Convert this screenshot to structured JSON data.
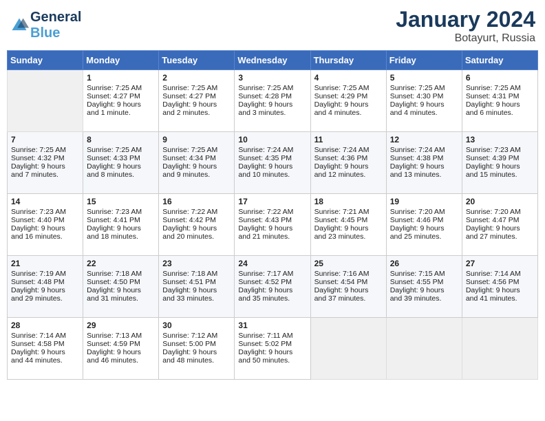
{
  "header": {
    "logo_general": "General",
    "logo_blue": "Blue",
    "month_title": "January 2024",
    "location": "Botayurt, Russia"
  },
  "weekdays": [
    "Sunday",
    "Monday",
    "Tuesday",
    "Wednesday",
    "Thursday",
    "Friday",
    "Saturday"
  ],
  "weeks": [
    [
      {
        "day": "",
        "empty": true
      },
      {
        "day": "1",
        "sunrise": "7:25 AM",
        "sunset": "4:27 PM",
        "daylight": "9 hours and 1 minute."
      },
      {
        "day": "2",
        "sunrise": "7:25 AM",
        "sunset": "4:27 PM",
        "daylight": "9 hours and 2 minutes."
      },
      {
        "day": "3",
        "sunrise": "7:25 AM",
        "sunset": "4:28 PM",
        "daylight": "9 hours and 3 minutes."
      },
      {
        "day": "4",
        "sunrise": "7:25 AM",
        "sunset": "4:29 PM",
        "daylight": "9 hours and 4 minutes."
      },
      {
        "day": "5",
        "sunrise": "7:25 AM",
        "sunset": "4:30 PM",
        "daylight": "9 hours and 4 minutes."
      },
      {
        "day": "6",
        "sunrise": "7:25 AM",
        "sunset": "4:31 PM",
        "daylight": "9 hours and 6 minutes."
      }
    ],
    [
      {
        "day": "7",
        "sunrise": "7:25 AM",
        "sunset": "4:32 PM",
        "daylight": "9 hours and 7 minutes."
      },
      {
        "day": "8",
        "sunrise": "7:25 AM",
        "sunset": "4:33 PM",
        "daylight": "9 hours and 8 minutes."
      },
      {
        "day": "9",
        "sunrise": "7:25 AM",
        "sunset": "4:34 PM",
        "daylight": "9 hours and 9 minutes."
      },
      {
        "day": "10",
        "sunrise": "7:24 AM",
        "sunset": "4:35 PM",
        "daylight": "9 hours and 10 minutes."
      },
      {
        "day": "11",
        "sunrise": "7:24 AM",
        "sunset": "4:36 PM",
        "daylight": "9 hours and 12 minutes."
      },
      {
        "day": "12",
        "sunrise": "7:24 AM",
        "sunset": "4:38 PM",
        "daylight": "9 hours and 13 minutes."
      },
      {
        "day": "13",
        "sunrise": "7:23 AM",
        "sunset": "4:39 PM",
        "daylight": "9 hours and 15 minutes."
      }
    ],
    [
      {
        "day": "14",
        "sunrise": "7:23 AM",
        "sunset": "4:40 PM",
        "daylight": "9 hours and 16 minutes."
      },
      {
        "day": "15",
        "sunrise": "7:23 AM",
        "sunset": "4:41 PM",
        "daylight": "9 hours and 18 minutes."
      },
      {
        "day": "16",
        "sunrise": "7:22 AM",
        "sunset": "4:42 PM",
        "daylight": "9 hours and 20 minutes."
      },
      {
        "day": "17",
        "sunrise": "7:22 AM",
        "sunset": "4:43 PM",
        "daylight": "9 hours and 21 minutes."
      },
      {
        "day": "18",
        "sunrise": "7:21 AM",
        "sunset": "4:45 PM",
        "daylight": "9 hours and 23 minutes."
      },
      {
        "day": "19",
        "sunrise": "7:20 AM",
        "sunset": "4:46 PM",
        "daylight": "9 hours and 25 minutes."
      },
      {
        "day": "20",
        "sunrise": "7:20 AM",
        "sunset": "4:47 PM",
        "daylight": "9 hours and 27 minutes."
      }
    ],
    [
      {
        "day": "21",
        "sunrise": "7:19 AM",
        "sunset": "4:48 PM",
        "daylight": "9 hours and 29 minutes."
      },
      {
        "day": "22",
        "sunrise": "7:18 AM",
        "sunset": "4:50 PM",
        "daylight": "9 hours and 31 minutes."
      },
      {
        "day": "23",
        "sunrise": "7:18 AM",
        "sunset": "4:51 PM",
        "daylight": "9 hours and 33 minutes."
      },
      {
        "day": "24",
        "sunrise": "7:17 AM",
        "sunset": "4:52 PM",
        "daylight": "9 hours and 35 minutes."
      },
      {
        "day": "25",
        "sunrise": "7:16 AM",
        "sunset": "4:54 PM",
        "daylight": "9 hours and 37 minutes."
      },
      {
        "day": "26",
        "sunrise": "7:15 AM",
        "sunset": "4:55 PM",
        "daylight": "9 hours and 39 minutes."
      },
      {
        "day": "27",
        "sunrise": "7:14 AM",
        "sunset": "4:56 PM",
        "daylight": "9 hours and 41 minutes."
      }
    ],
    [
      {
        "day": "28",
        "sunrise": "7:14 AM",
        "sunset": "4:58 PM",
        "daylight": "9 hours and 44 minutes."
      },
      {
        "day": "29",
        "sunrise": "7:13 AM",
        "sunset": "4:59 PM",
        "daylight": "9 hours and 46 minutes."
      },
      {
        "day": "30",
        "sunrise": "7:12 AM",
        "sunset": "5:00 PM",
        "daylight": "9 hours and 48 minutes."
      },
      {
        "day": "31",
        "sunrise": "7:11 AM",
        "sunset": "5:02 PM",
        "daylight": "9 hours and 50 minutes."
      },
      {
        "day": "",
        "empty": true
      },
      {
        "day": "",
        "empty": true
      },
      {
        "day": "",
        "empty": true
      }
    ]
  ]
}
